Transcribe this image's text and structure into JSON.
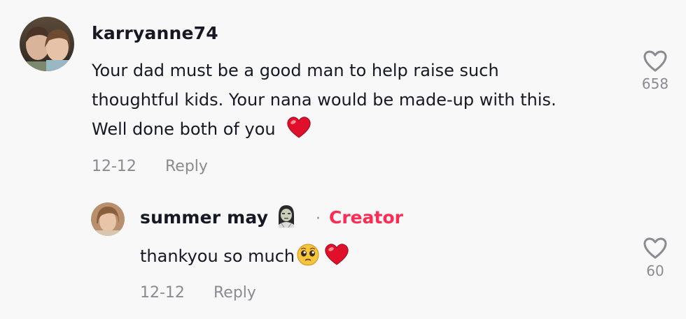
{
  "comments": [
    {
      "username": "karryanne74",
      "lines": [
        "Your dad must be a good man to help raise such",
        "thoughtful kids. Your nana would be made-up with this.",
        "Well done both of you"
      ],
      "date": "12-12",
      "reply_label": "Reply",
      "likes": "658",
      "trailing_emoji": "red-heart-icon"
    },
    {
      "username": "summer may",
      "badge_emoji": "woman-zombie-icon",
      "separator": "·",
      "creator_label": "Creator",
      "text": "thankyou so much",
      "emojis": [
        "pleading-face-icon",
        "red-heart-icon"
      ],
      "date": "12-12",
      "reply_label": "Reply",
      "likes": "60"
    }
  ],
  "colors": {
    "background": "#f8f8f8",
    "text": "#161823",
    "muted": "#8a8b91",
    "creator": "#fe2c55",
    "heart": "#e0102b"
  }
}
